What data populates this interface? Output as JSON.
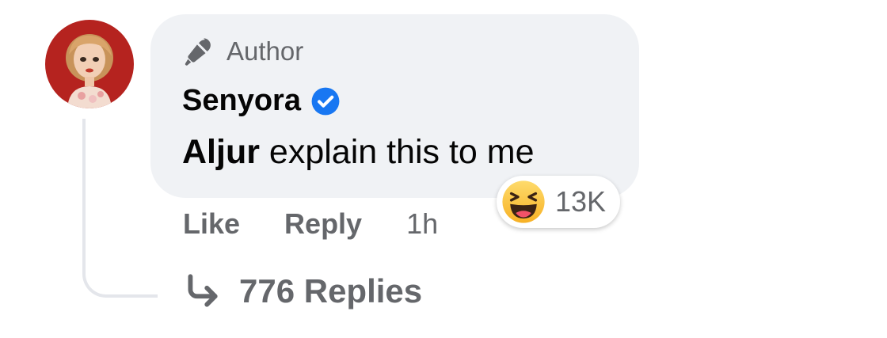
{
  "comment": {
    "author_badge": "Author",
    "author_name": "Senyora",
    "text_mention": "Aljur",
    "text_rest": " explain this to me",
    "reaction_count": "13K",
    "reaction_icon": "haha-emoji-icon"
  },
  "actions": {
    "like_label": "Like",
    "reply_label": "Reply",
    "timestamp": "1h"
  },
  "replies": {
    "label": "776 Replies"
  },
  "colors": {
    "bubble": "#f0f2f5",
    "secondary_text": "#65676b",
    "verified_blue": "#1877f2",
    "thread_line": "#e4e6eb",
    "avatar_bg": "#b5231f"
  }
}
